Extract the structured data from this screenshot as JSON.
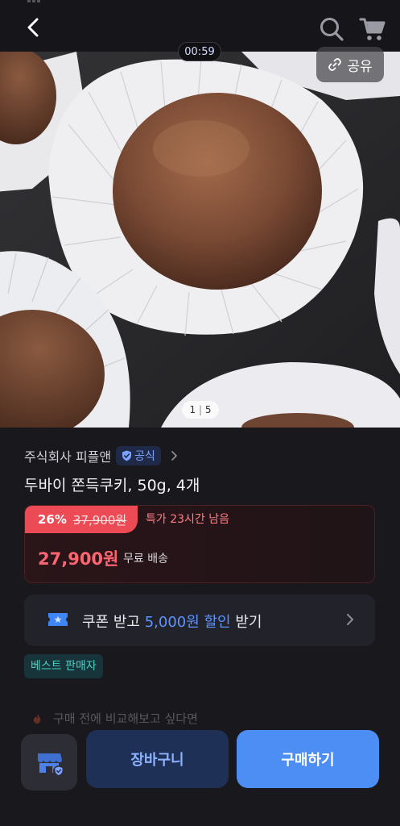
{
  "header": {
    "back_icon": "chevron-left-icon",
    "search_icon": "search-icon",
    "cart_icon": "cart-icon"
  },
  "media": {
    "video_timer": "00:59",
    "share_label": "공유",
    "share_icon": "link-icon",
    "page_current": "1",
    "page_separator": "|",
    "page_total": "5"
  },
  "product": {
    "seller_name": "주식회사 피플앤",
    "official_label": "공식",
    "title": "두바이 쫀득쿠키, 50g, 4개"
  },
  "price": {
    "discount_rate": "26%",
    "original_price": "37,900원",
    "deal_text": "특가 23시간 남음",
    "sale_price": "27,900원",
    "shipping": "무료 배송"
  },
  "coupon": {
    "prefix": "쿠폰 받고 ",
    "amount": "5,000원 할인",
    "suffix": " 받기"
  },
  "badges": {
    "best_seller": "베스트 판매자"
  },
  "compare": {
    "text": "구매 전에 비교해보고 싶다면"
  },
  "actions": {
    "cart_label": "장바구니",
    "buy_label": "구매하기"
  },
  "colors": {
    "accent_blue": "#4d8ef4",
    "price_red": "#ff6570",
    "discount_red": "#ec4b55",
    "best_teal": "#49d0c4"
  }
}
